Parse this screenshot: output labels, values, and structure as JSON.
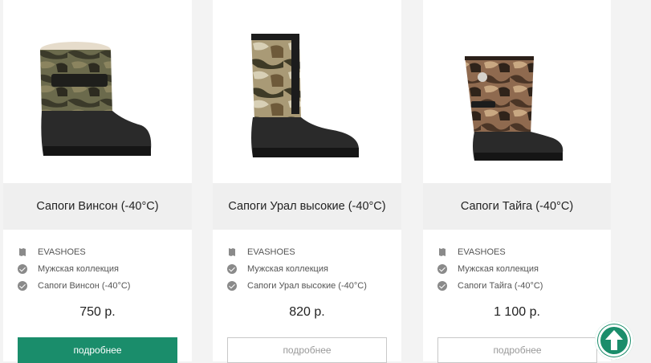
{
  "products": [
    {
      "title": "Сапоги Винсон (-40°C)",
      "brand": "EVASHOES",
      "collection": "Мужская коллекция",
      "model": "Сапоги Винсон (-40°C)",
      "price": "750 р.",
      "button_label": "подробнее",
      "button_style": "solid"
    },
    {
      "title": "Сапоги Урал высокие (-40°C)",
      "brand": "EVASHOES",
      "collection": "Мужская коллекция",
      "model": "Сапоги Урал высокие (-40°C)",
      "price": "820 р.",
      "button_label": "подробнее",
      "button_style": "outline"
    },
    {
      "title": "Сапоги Тайга (-40°C)",
      "brand": "EVASHOES",
      "collection": "Мужская коллекция",
      "model": "Сапоги Тайга (-40°C)",
      "price": "1 100 р.",
      "button_label": "подробнее",
      "button_style": "outline"
    }
  ],
  "colors": {
    "accent": "#1a8d6b",
    "title_band": "#efefef",
    "icon_gray": "#8a8a8a"
  },
  "icons": {
    "brand": "leather-icon",
    "property": "check-circle-icon",
    "scroll_top": "arrow-up-icon"
  }
}
